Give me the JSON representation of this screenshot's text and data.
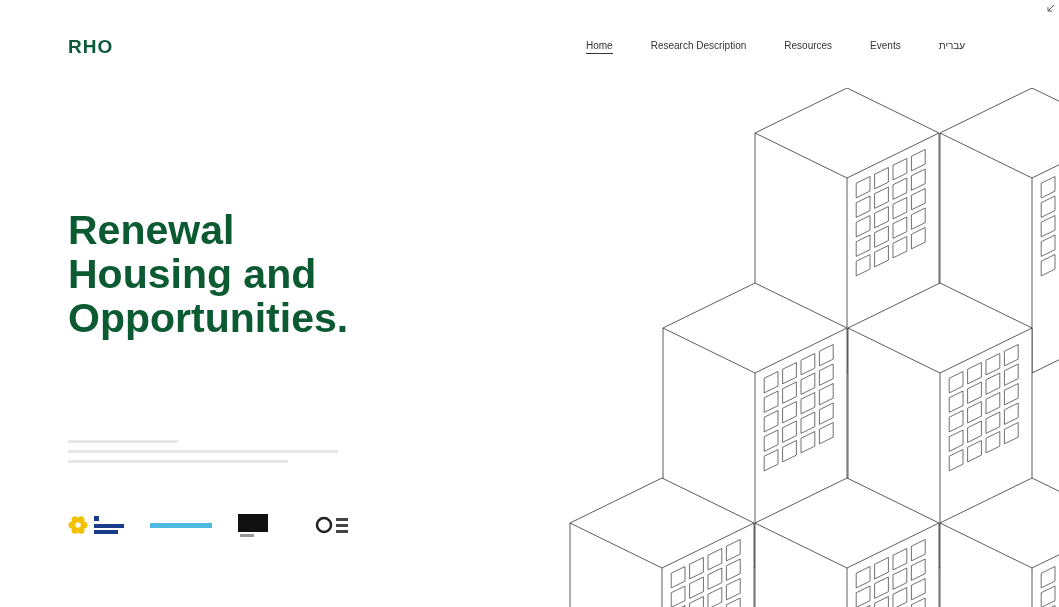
{
  "logo": "RHO",
  "nav": [
    {
      "label": "Home",
      "selected": true
    },
    {
      "label": "Research Description",
      "selected": false
    },
    {
      "label": "Resources",
      "selected": false
    },
    {
      "label": "Events",
      "selected": false
    },
    {
      "label": "עברית",
      "selected": false
    }
  ],
  "hero": {
    "title": "Renewal Housing and Opportunities."
  }
}
